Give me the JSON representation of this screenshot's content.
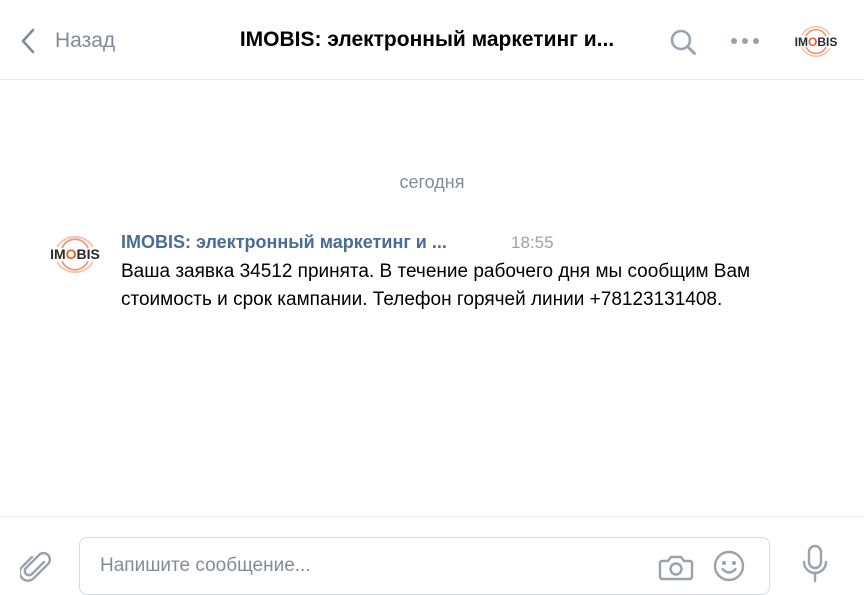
{
  "header": {
    "back_label": "Назад",
    "title": "IMOBIS: электронный маркетинг и..."
  },
  "chat": {
    "date_separator": "сегодня",
    "messages": [
      {
        "author": "IMOBIS: электронный маркетинг и ...",
        "time": "18:55",
        "text": "Ваша заявка 34512 принята. В течение рабочего дня мы сообщим Вам стоимость и срок кампании. Телефон горячей линии +78123131408."
      }
    ]
  },
  "composer": {
    "placeholder": "Напишите сообщение..."
  },
  "logo": {
    "text_dark": "IM",
    "text_accent": "O",
    "text_dark2": "BIS"
  },
  "colors": {
    "accent_orange": "#e8622b",
    "link_blue": "#4a6d93",
    "muted_gray": "#818c99",
    "icon_gray": "#99a2ad"
  },
  "icons": [
    "chevron-left-icon",
    "search-icon",
    "more-icon",
    "attach-icon",
    "camera-icon",
    "emoji-icon",
    "microphone-icon"
  ]
}
